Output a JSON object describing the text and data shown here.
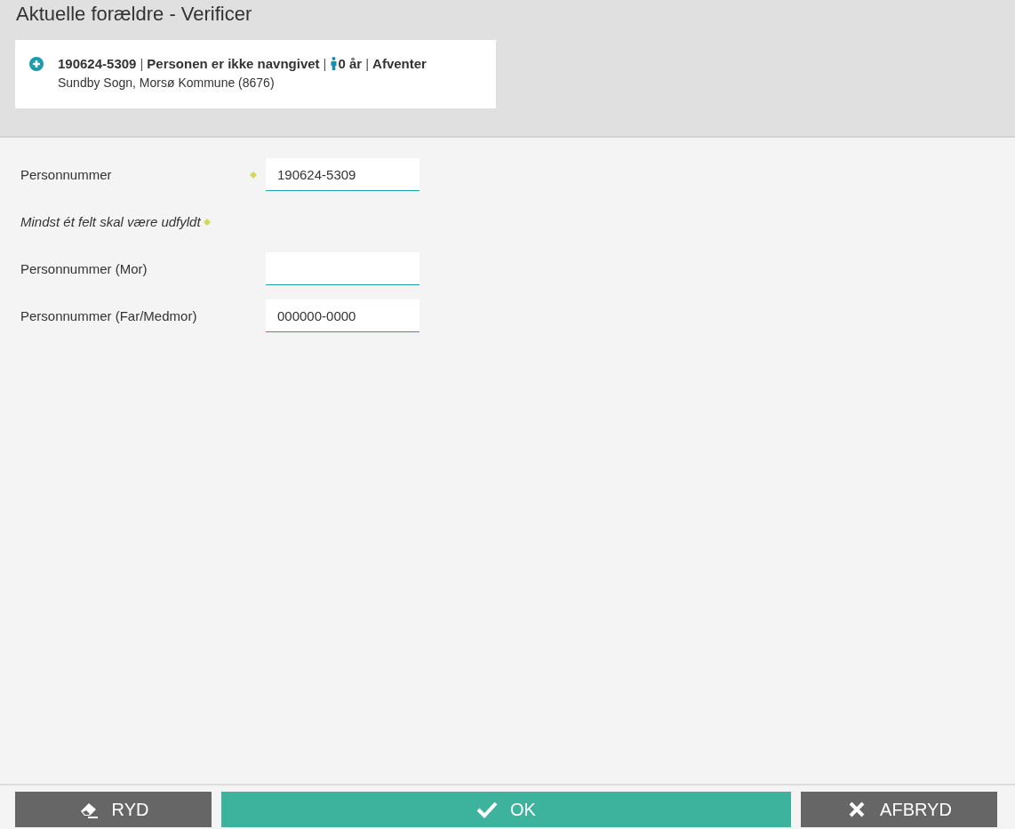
{
  "header": {
    "title": "Aktuelle forældre - Verificer"
  },
  "person_card": {
    "expanded": false,
    "parts": [
      {
        "kind": "text",
        "text": "190624-5309"
      },
      {
        "kind": "separator",
        "text": "|"
      },
      {
        "kind": "text",
        "text": "Personen er ikke navngivet"
      },
      {
        "kind": "separator",
        "text": "|"
      },
      {
        "kind": "age",
        "text": "0 år"
      },
      {
        "kind": "separator",
        "text": "|"
      },
      {
        "kind": "text",
        "text": "Afventer"
      }
    ],
    "location": "Sundby Sogn, Morsø Kommune (8676)"
  },
  "form": [
    {
      "kind": "field",
      "label": "Personnummer",
      "required": true,
      "value": "190624-5309"
    },
    {
      "kind": "note",
      "label": "Mindst ét felt skal være udfyldt",
      "required": true
    },
    {
      "kind": "field",
      "label": "Personnummer (Mor)",
      "required": false
    },
    {
      "kind": "field",
      "label": "Personnummer (Far/Medmor)",
      "required": false,
      "value": "000000-0000"
    }
  ],
  "buttons": [
    {
      "kind": "eraser",
      "label": "RYD",
      "primary": false
    },
    {
      "kind": "check",
      "label": "OK",
      "primary": true
    },
    {
      "kind": "cross",
      "label": "AFBRYD",
      "primary": false
    }
  ]
}
